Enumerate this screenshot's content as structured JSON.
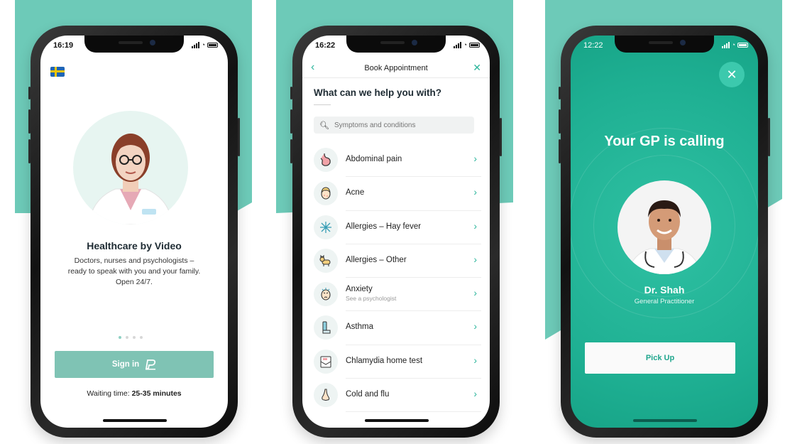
{
  "colors": {
    "brand_teal": "#6dcab8",
    "accent_green": "#2bb59b",
    "call_bg": "#1eaf92"
  },
  "screen1": {
    "status_time": "16:19",
    "flag_icon": "sweden-flag-icon",
    "title": "Healthcare by Video",
    "description_lines": [
      "Doctors, nurses and psychologists –",
      "ready to speak with you and your family.",
      "Open 24/7."
    ],
    "pager": {
      "count": 4,
      "active": 1
    },
    "signin_label": "Sign in",
    "bankid_icon": "bankid-icon",
    "waiting_label": "Waiting time:",
    "waiting_value": "25-35 minutes"
  },
  "screen2": {
    "status_time": "16:22",
    "nav_title": "Book Appointment",
    "question": "What can we help you with?",
    "search_placeholder": "Symptoms and conditions",
    "items": [
      {
        "label": "Abdominal pain",
        "icon": "stomach-icon"
      },
      {
        "label": "Acne",
        "icon": "face-icon"
      },
      {
        "label": "Allergies – Hay fever",
        "icon": "pollen-icon"
      },
      {
        "label": "Allergies – Other",
        "icon": "cat-icon"
      },
      {
        "label": "Anxiety",
        "sub": "See a psychologist",
        "icon": "worried-face-icon"
      },
      {
        "label": "Asthma",
        "icon": "inhaler-icon"
      },
      {
        "label": "Chlamydia home test",
        "icon": "test-kit-icon"
      },
      {
        "label": "Cold and flu",
        "icon": "nose-icon"
      }
    ]
  },
  "screen3": {
    "status_time": "12:22",
    "heading": "Your GP is calling",
    "doctor_name": "Dr. Shah",
    "doctor_role": "General Practitioner",
    "pickup_label": "Pick Up"
  }
}
